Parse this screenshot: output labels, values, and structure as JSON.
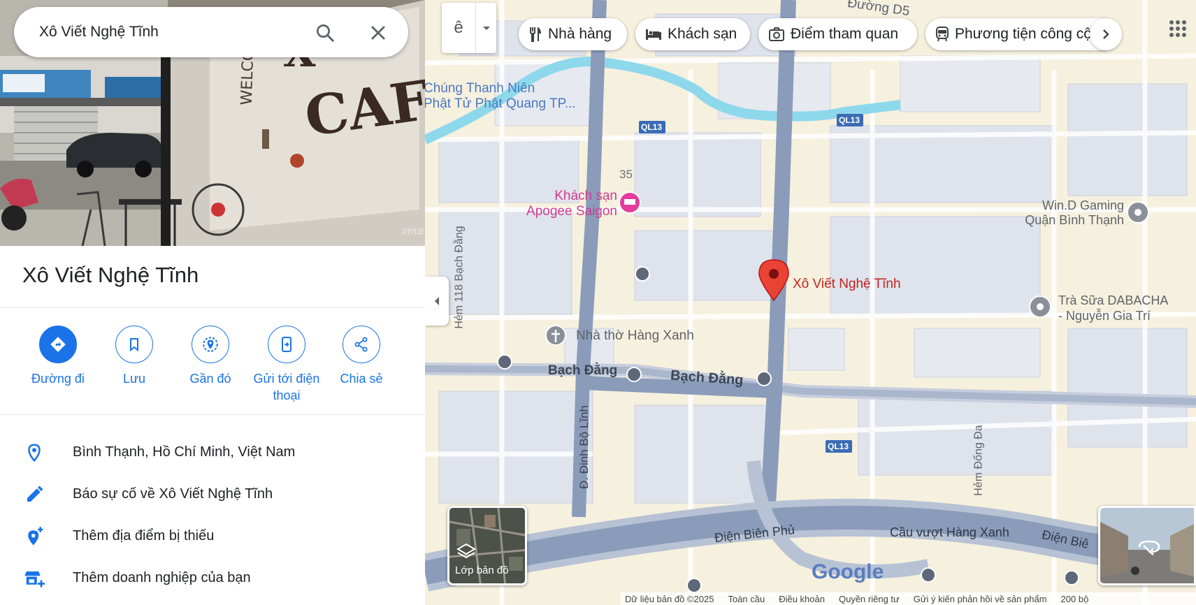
{
  "search": {
    "value": "Xô Viết Nghệ Tĩnh"
  },
  "hero": {
    "date": "07/12/"
  },
  "place": {
    "title": "Xô Viết Nghệ Tĩnh",
    "actions": [
      {
        "label": "Đường đi",
        "icon": "directions-icon"
      },
      {
        "label": "Lưu",
        "icon": "bookmark-icon"
      },
      {
        "label": "Gần đó",
        "icon": "nearby-icon"
      },
      {
        "label": "Gửi tới điện thoại",
        "icon": "send-to-phone-icon"
      },
      {
        "label": "Chia sẻ",
        "icon": "share-icon"
      }
    ],
    "info": [
      {
        "text": "Bình Thạnh, Hồ Chí Minh, Việt Nam",
        "icon": "location-pin-icon"
      },
      {
        "text": "Báo sự cố về Xô Viết Nghệ Tĩnh",
        "icon": "pencil-icon"
      },
      {
        "text": "Thêm địa điểm bị thiếu",
        "icon": "add-location-icon"
      },
      {
        "text": "Thêm doanh nghiệp của bạn",
        "icon": "add-business-icon"
      }
    ]
  },
  "map": {
    "layer_toggle": "ê",
    "chips": [
      {
        "label": "Nhà hàng",
        "icon": "restaurant-icon"
      },
      {
        "label": "Khách sạn",
        "icon": "hotel-icon"
      },
      {
        "label": "Điểm tham quan",
        "icon": "camera-icon"
      },
      {
        "label": "Phương tiện công cộng",
        "icon": "transit-icon"
      }
    ],
    "labels": {
      "duong_d5": "Đường D5",
      "chung_thanh_nien_1": "Chúng Thanh Niên",
      "chung_thanh_nien_2": "Phật Tử Phật Quang TP...",
      "ql13_a": "QL13",
      "ql13_b": "QL13",
      "ql13_c": "QL13",
      "num_35": "35",
      "apogee_1": "Khách sạn",
      "apogee_2": "Apogee Saigon",
      "wind_1": "Win.D Gaming",
      "wind_2": "Quận Bình Thạnh",
      "hem118": "Hẻm 118 Bạch Đằng",
      "marker": "Xô Viết Nghệ Tĩnh",
      "trasua_1": "Trà Sữa DABACHA",
      "trasua_2": "- Nguyễn Gia Trí",
      "nhatho": "Nhà thờ Hàng Xanh",
      "bachdang_1": "Bạch Đằng",
      "bachdang_2": "Bạch Đằng",
      "dinhbolinh": "Đ. Đinh Bộ Lĩnh",
      "hemdongda": "Hẻm Đống Đa",
      "dienbienphu": "Điện Biên Phủ",
      "cauvuot": "Cầu vượt Hàng Xanh",
      "dienbie": "Điện Biê",
      "google": "Google"
    },
    "layers_label": "Lớp bản đồ",
    "footer": {
      "copyright": "Dữ liệu bản đồ ©2025",
      "global": "Toàn cầu",
      "terms": "Điều khoản",
      "privacy": "Quyền riêng tư",
      "feedback": "Gửi ý kiến phản hồi về sản phẩm",
      "scale": "200 bộ"
    }
  }
}
